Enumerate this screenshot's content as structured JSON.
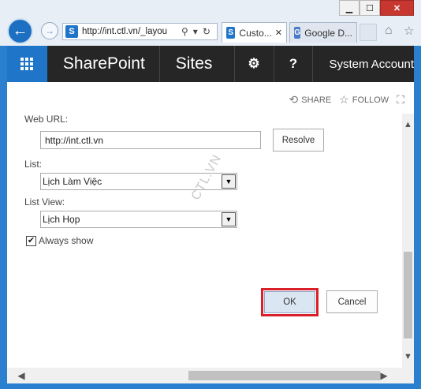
{
  "window": {
    "minimize_label": "▁",
    "maximize_label": "☐",
    "close_label": "✕"
  },
  "browser": {
    "address": "http://int.ctl.vn/_layou",
    "address_icons": [
      "search-icon",
      "refresh-icon"
    ],
    "tabs": [
      {
        "label": "Custo...",
        "close": "✕",
        "active": true
      },
      {
        "label": "Google D...",
        "close": "",
        "active": false
      }
    ]
  },
  "suitebar": {
    "brand": "SharePoint",
    "sites": "Sites",
    "help": "?",
    "account": "System Account"
  },
  "actions": {
    "share": "SHARE",
    "follow": "FOLLOW"
  },
  "form": {
    "web_url_label": "Web URL:",
    "web_url_value": "http://int.ctl.vn",
    "resolve_label": "Resolve",
    "list_label": "List:",
    "list_value": "Lịch Làm Việc",
    "list_view_label": "List View:",
    "list_view_value": "Lịch Họp",
    "always_show_label": "Always show",
    "always_show_checked": true,
    "ok_label": "OK",
    "cancel_label": "Cancel"
  },
  "watermark": "CTL.VN",
  "colors": {
    "accent": "#1f76c9",
    "suitebar": "#262626",
    "highlight": "#d9202a"
  }
}
